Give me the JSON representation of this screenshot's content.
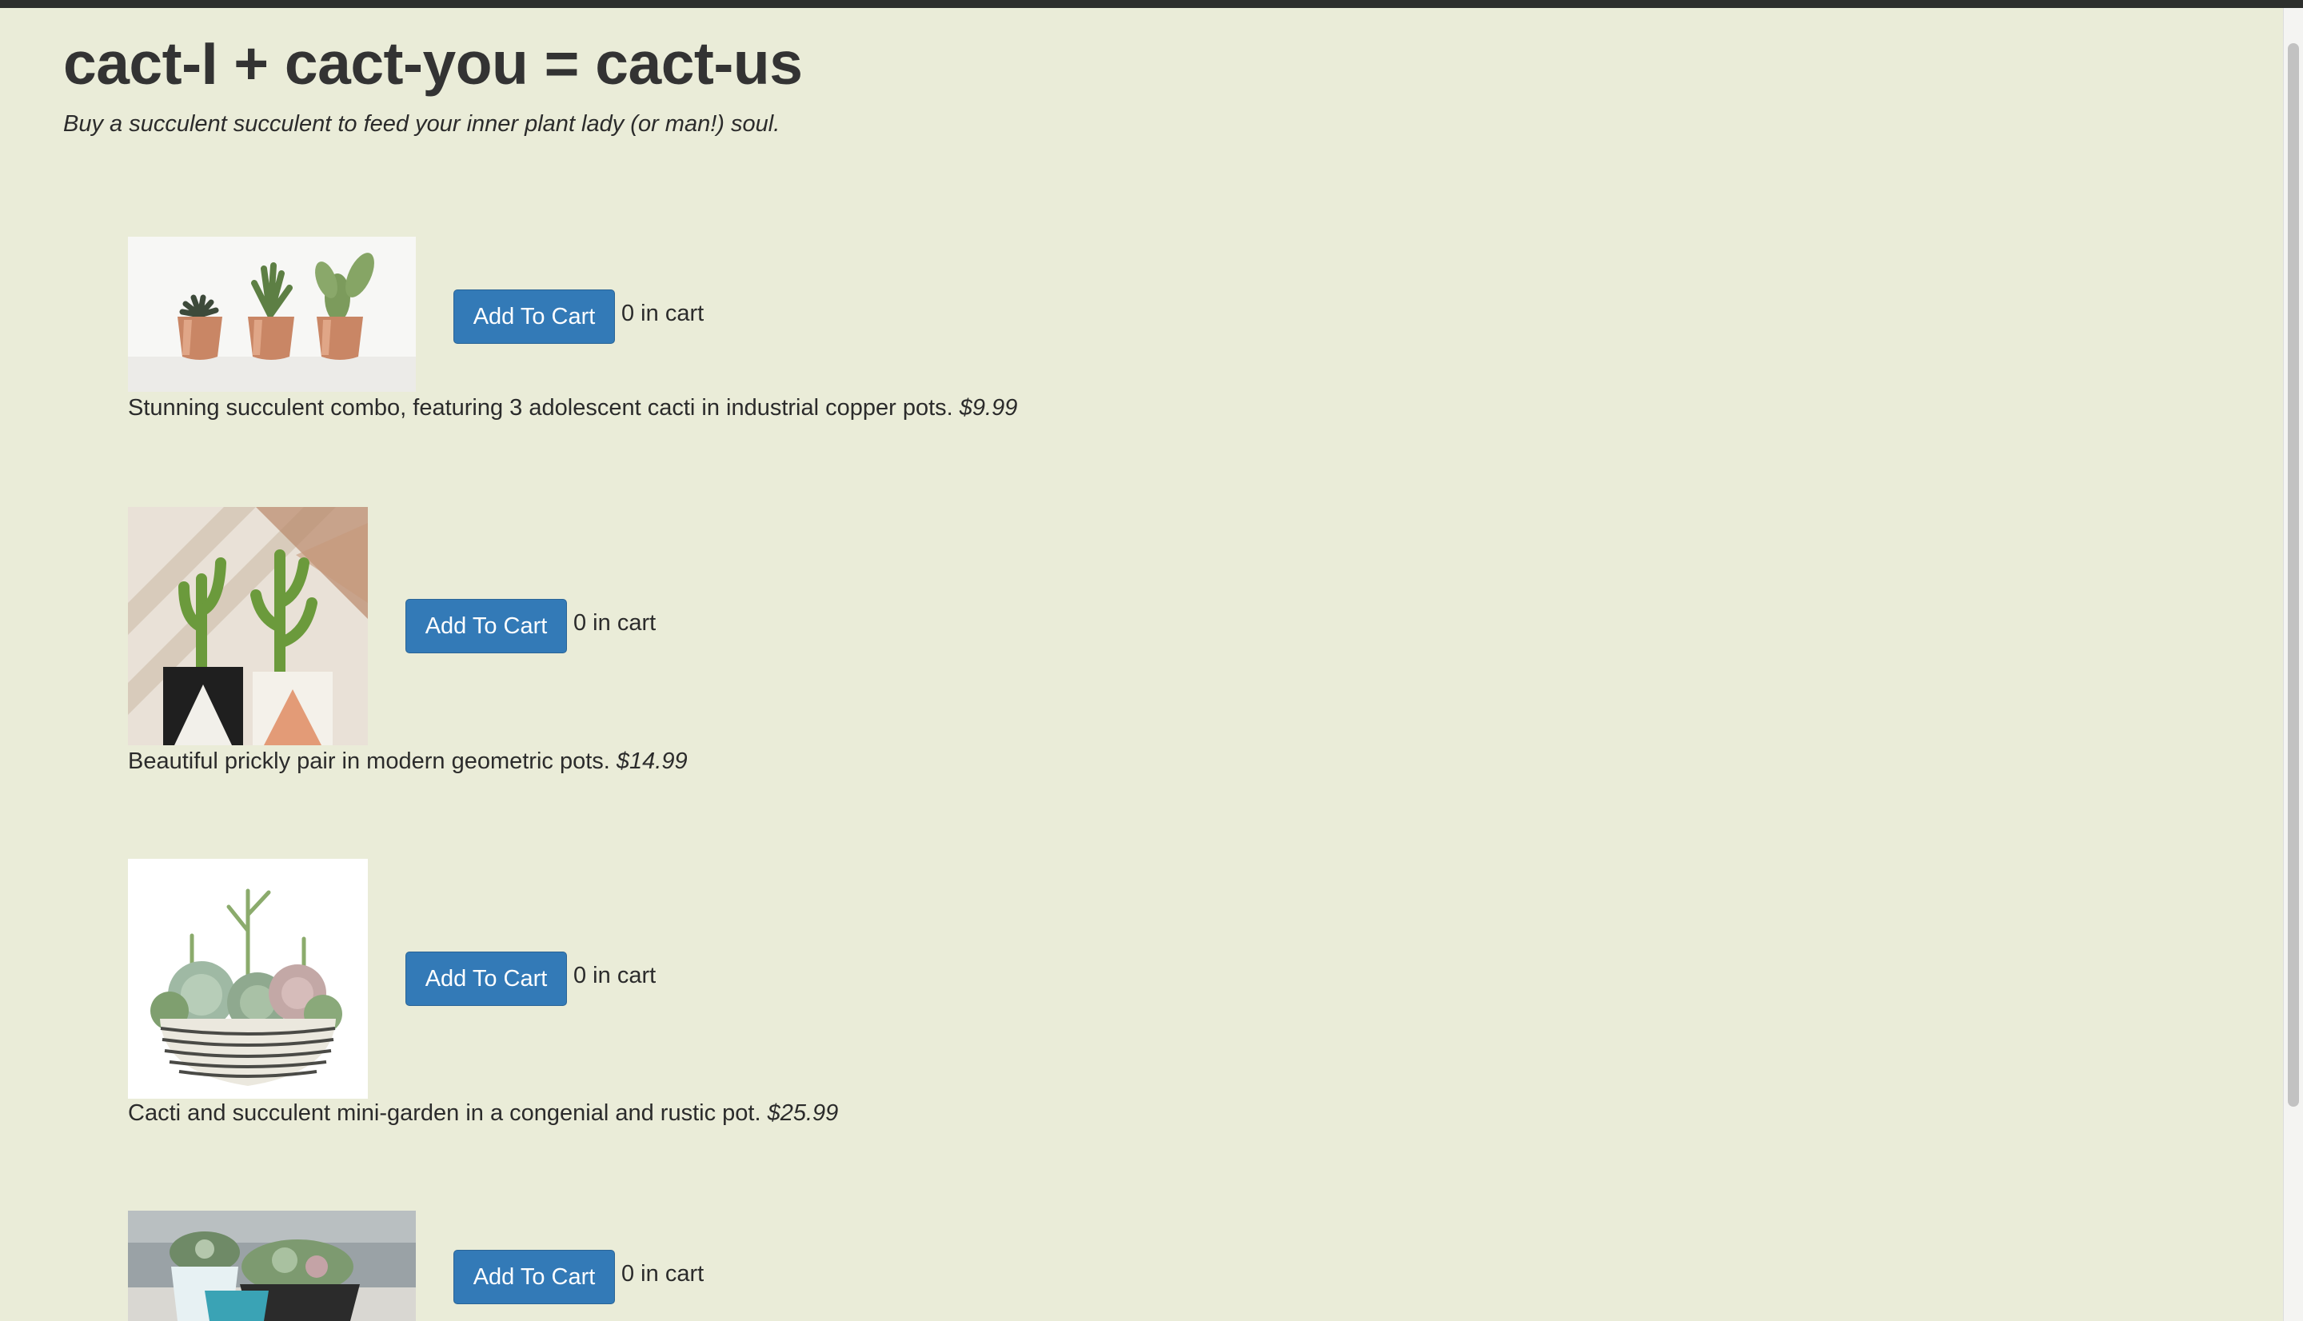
{
  "header": {
    "title": "cact-I + cact-you = cact-us",
    "tagline": "Buy a succulent succulent to feed your inner plant lady (or man!) soul."
  },
  "products": [
    {
      "image_name": "three-copper-pot-cacti-image",
      "button_label": "Add To Cart",
      "cart_count": "0 in cart",
      "description": "Stunning succulent combo, featuring 3 adolescent cacti in industrial copper pots.",
      "price": "$9.99"
    },
    {
      "image_name": "geometric-pot-cacti-pair-image",
      "button_label": "Add To Cart",
      "cart_count": "0 in cart",
      "description": "Beautiful prickly pair in modern geometric pots.",
      "price": "$14.99"
    },
    {
      "image_name": "succulent-mini-garden-image",
      "button_label": "Add To Cart",
      "cart_count": "0 in cart",
      "description": "Cacti and succulent mini-garden in a congenial and rustic pot.",
      "price": "$25.99"
    },
    {
      "image_name": "succulent-bowls-image",
      "button_label": "Add To Cart",
      "cart_count": "0 in cart",
      "description": "",
      "price": ""
    }
  ],
  "colors": {
    "background": "#eaecd8",
    "button": "#337ab7",
    "button_text": "#ffffff",
    "topbar": "#2d2f2d"
  }
}
